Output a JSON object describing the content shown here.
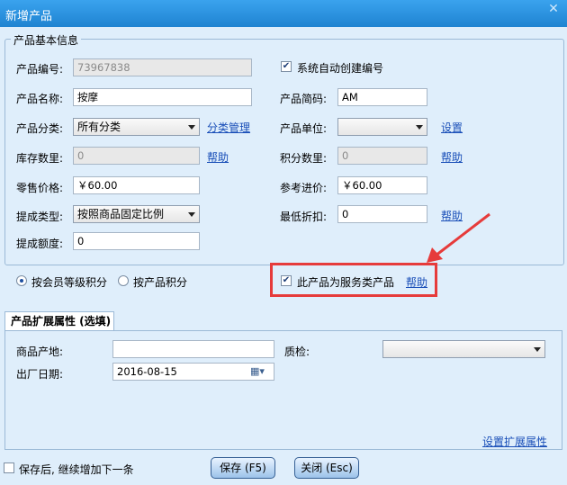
{
  "window": {
    "title": "新增产品"
  },
  "basic_group": {
    "legend": "产品基本信息"
  },
  "fields": {
    "code_label": "产品编号:",
    "code_value": "73967838",
    "auto_code_label": "系统自动创建编号",
    "name_label": "产品名称:",
    "name_value": "按摩",
    "short_code_label": "产品简码:",
    "short_code_value": "AM",
    "category_label": "产品分类:",
    "category_value": "所有分类",
    "category_manage_link": "分类管理",
    "unit_label": "产品单位:",
    "unit_value": "",
    "unit_settings_link": "设置",
    "stock_label": "库存数里:",
    "stock_value": "0",
    "stock_help_link": "帮助",
    "points_label": "积分数里:",
    "points_value": "0",
    "points_help_link": "帮助",
    "retail_price_label": "零售价格:",
    "retail_price_value": "￥60.00",
    "ref_price_label": "参考进价:",
    "ref_price_value": "￥60.00",
    "commission_type_label": "提成类型:",
    "commission_type_value": "按照商品固定比例",
    "min_discount_label": "最低折扣:",
    "min_discount_value": "0",
    "min_discount_help_link": "帮助",
    "commission_amount_label": "提成额度:",
    "commission_amount_value": "0"
  },
  "points_mode": {
    "by_member_level": "按会员等级积分",
    "by_product": "按产品积分",
    "selected": "by_member_level"
  },
  "service_product": {
    "label": "此产品为服务类产品",
    "checked": true,
    "help_link": "帮助"
  },
  "ext_tab": {
    "label": "产品扩展属性 (选填)",
    "origin_label": "商品产地:",
    "origin_value": "",
    "qc_label": "质检:",
    "qc_value": "",
    "mfg_date_label": "出厂日期:",
    "mfg_date_value": "2016-08-15",
    "settings_link": "设置扩展属性"
  },
  "footer": {
    "continue_label": "保存后, 继续增加下一条",
    "save_button": "保存 (F5)",
    "close_button": "关闭 (Esc)"
  },
  "annotation": {
    "color": "#e63b3b"
  }
}
